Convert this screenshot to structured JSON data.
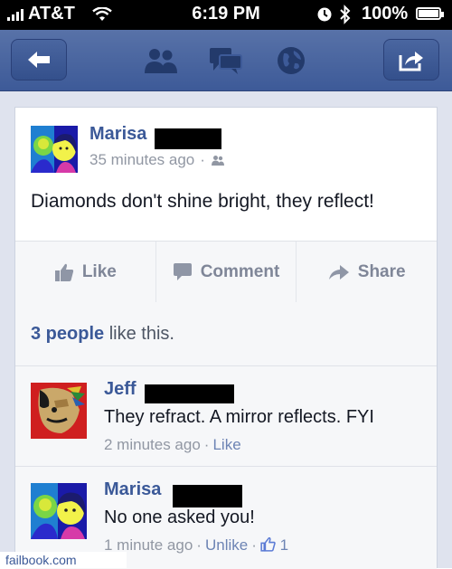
{
  "status_bar": {
    "carrier": "AT&T",
    "time": "6:19 PM",
    "battery": "100%"
  },
  "nav": {
    "icons": [
      "back-arrow-icon",
      "friends-icon",
      "messages-icon",
      "globe-icon",
      "share-icon"
    ]
  },
  "post": {
    "author": "Marisa",
    "time": "35 minutes ago",
    "text": "Diamonds don't shine bright, they reflect!"
  },
  "actions": {
    "like": "Like",
    "comment": "Comment",
    "share": "Share"
  },
  "likes": {
    "count": "3 people",
    "rest": " like this."
  },
  "comments": [
    {
      "author": "Jeff",
      "text": "They refract. A mirror reflects. FYI",
      "time": "2 minutes ago",
      "action": "Like"
    },
    {
      "author": "Marisa",
      "text": "No one asked you!",
      "time": "1 minute ago",
      "action": "Unlike",
      "like_count": "1"
    }
  ],
  "watermark": "failbook.com",
  "colors": {
    "facebook_blue": "#3b5998",
    "navbar": "#4a66a0",
    "feed_bg": "#dfe3ee",
    "meta_gray": "#9197a3"
  }
}
